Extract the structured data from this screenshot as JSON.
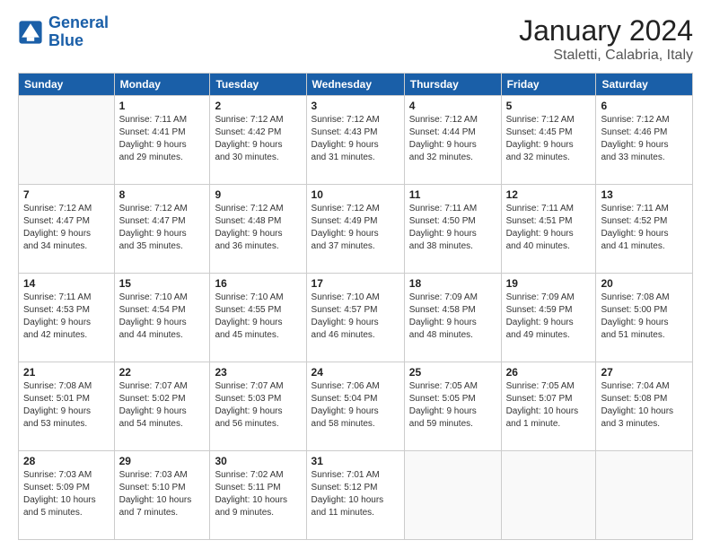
{
  "header": {
    "logo_line1": "General",
    "logo_line2": "Blue",
    "title": "January 2024",
    "subtitle": "Staletti, Calabria, Italy"
  },
  "calendar": {
    "weekdays": [
      "Sunday",
      "Monday",
      "Tuesday",
      "Wednesday",
      "Thursday",
      "Friday",
      "Saturday"
    ],
    "rows": [
      [
        {
          "day": "",
          "info": ""
        },
        {
          "day": "1",
          "info": "Sunrise: 7:11 AM\nSunset: 4:41 PM\nDaylight: 9 hours\nand 29 minutes."
        },
        {
          "day": "2",
          "info": "Sunrise: 7:12 AM\nSunset: 4:42 PM\nDaylight: 9 hours\nand 30 minutes."
        },
        {
          "day": "3",
          "info": "Sunrise: 7:12 AM\nSunset: 4:43 PM\nDaylight: 9 hours\nand 31 minutes."
        },
        {
          "day": "4",
          "info": "Sunrise: 7:12 AM\nSunset: 4:44 PM\nDaylight: 9 hours\nand 32 minutes."
        },
        {
          "day": "5",
          "info": "Sunrise: 7:12 AM\nSunset: 4:45 PM\nDaylight: 9 hours\nand 32 minutes."
        },
        {
          "day": "6",
          "info": "Sunrise: 7:12 AM\nSunset: 4:46 PM\nDaylight: 9 hours\nand 33 minutes."
        }
      ],
      [
        {
          "day": "7",
          "info": "Sunrise: 7:12 AM\nSunset: 4:47 PM\nDaylight: 9 hours\nand 34 minutes."
        },
        {
          "day": "8",
          "info": "Sunrise: 7:12 AM\nSunset: 4:47 PM\nDaylight: 9 hours\nand 35 minutes."
        },
        {
          "day": "9",
          "info": "Sunrise: 7:12 AM\nSunset: 4:48 PM\nDaylight: 9 hours\nand 36 minutes."
        },
        {
          "day": "10",
          "info": "Sunrise: 7:12 AM\nSunset: 4:49 PM\nDaylight: 9 hours\nand 37 minutes."
        },
        {
          "day": "11",
          "info": "Sunrise: 7:11 AM\nSunset: 4:50 PM\nDaylight: 9 hours\nand 38 minutes."
        },
        {
          "day": "12",
          "info": "Sunrise: 7:11 AM\nSunset: 4:51 PM\nDaylight: 9 hours\nand 40 minutes."
        },
        {
          "day": "13",
          "info": "Sunrise: 7:11 AM\nSunset: 4:52 PM\nDaylight: 9 hours\nand 41 minutes."
        }
      ],
      [
        {
          "day": "14",
          "info": "Sunrise: 7:11 AM\nSunset: 4:53 PM\nDaylight: 9 hours\nand 42 minutes."
        },
        {
          "day": "15",
          "info": "Sunrise: 7:10 AM\nSunset: 4:54 PM\nDaylight: 9 hours\nand 44 minutes."
        },
        {
          "day": "16",
          "info": "Sunrise: 7:10 AM\nSunset: 4:55 PM\nDaylight: 9 hours\nand 45 minutes."
        },
        {
          "day": "17",
          "info": "Sunrise: 7:10 AM\nSunset: 4:57 PM\nDaylight: 9 hours\nand 46 minutes."
        },
        {
          "day": "18",
          "info": "Sunrise: 7:09 AM\nSunset: 4:58 PM\nDaylight: 9 hours\nand 48 minutes."
        },
        {
          "day": "19",
          "info": "Sunrise: 7:09 AM\nSunset: 4:59 PM\nDaylight: 9 hours\nand 49 minutes."
        },
        {
          "day": "20",
          "info": "Sunrise: 7:08 AM\nSunset: 5:00 PM\nDaylight: 9 hours\nand 51 minutes."
        }
      ],
      [
        {
          "day": "21",
          "info": "Sunrise: 7:08 AM\nSunset: 5:01 PM\nDaylight: 9 hours\nand 53 minutes."
        },
        {
          "day": "22",
          "info": "Sunrise: 7:07 AM\nSunset: 5:02 PM\nDaylight: 9 hours\nand 54 minutes."
        },
        {
          "day": "23",
          "info": "Sunrise: 7:07 AM\nSunset: 5:03 PM\nDaylight: 9 hours\nand 56 minutes."
        },
        {
          "day": "24",
          "info": "Sunrise: 7:06 AM\nSunset: 5:04 PM\nDaylight: 9 hours\nand 58 minutes."
        },
        {
          "day": "25",
          "info": "Sunrise: 7:05 AM\nSunset: 5:05 PM\nDaylight: 9 hours\nand 59 minutes."
        },
        {
          "day": "26",
          "info": "Sunrise: 7:05 AM\nSunset: 5:07 PM\nDaylight: 10 hours\nand 1 minute."
        },
        {
          "day": "27",
          "info": "Sunrise: 7:04 AM\nSunset: 5:08 PM\nDaylight: 10 hours\nand 3 minutes."
        }
      ],
      [
        {
          "day": "28",
          "info": "Sunrise: 7:03 AM\nSunset: 5:09 PM\nDaylight: 10 hours\nand 5 minutes."
        },
        {
          "day": "29",
          "info": "Sunrise: 7:03 AM\nSunset: 5:10 PM\nDaylight: 10 hours\nand 7 minutes."
        },
        {
          "day": "30",
          "info": "Sunrise: 7:02 AM\nSunset: 5:11 PM\nDaylight: 10 hours\nand 9 minutes."
        },
        {
          "day": "31",
          "info": "Sunrise: 7:01 AM\nSunset: 5:12 PM\nDaylight: 10 hours\nand 11 minutes."
        },
        {
          "day": "",
          "info": ""
        },
        {
          "day": "",
          "info": ""
        },
        {
          "day": "",
          "info": ""
        }
      ]
    ]
  }
}
